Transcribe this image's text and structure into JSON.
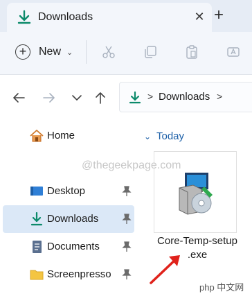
{
  "window": {
    "tab_title": "Downloads",
    "close_glyph": "✕",
    "new_tab_glyph": "+"
  },
  "toolbar": {
    "new_label": "New",
    "new_icon": "plus-circle-icon",
    "actions": [
      "cut-icon",
      "copy-icon",
      "paste-icon",
      "rename-icon"
    ]
  },
  "navigation": {
    "buttons": [
      "back-icon",
      "forward-icon",
      "recent-icon",
      "up-icon"
    ],
    "address": {
      "separator": ">",
      "location": "Downloads"
    }
  },
  "sidebar": {
    "home": "Home",
    "items": [
      {
        "label": "Desktop",
        "icon": "desktop-icon",
        "pinned": true
      },
      {
        "label": "Downloads",
        "icon": "download-icon",
        "pinned": true,
        "active": true
      },
      {
        "label": "Documents",
        "icon": "documents-icon",
        "pinned": true
      },
      {
        "label": "Screenpresso",
        "icon": "folder-icon",
        "pinned": true
      }
    ]
  },
  "content": {
    "group": "Today",
    "file": {
      "name_line1": "Core-Temp-setup",
      "name_line2": ".exe",
      "icon": "installer-icon"
    }
  },
  "overlay": {
    "watermark": "@thegeekpage.com",
    "badge": "php 中文网",
    "arrow_color": "#e0221b"
  },
  "colors": {
    "accent": "#0c8a6b",
    "group_blue": "#1c5fa8",
    "selection": "#dbe8f7"
  }
}
